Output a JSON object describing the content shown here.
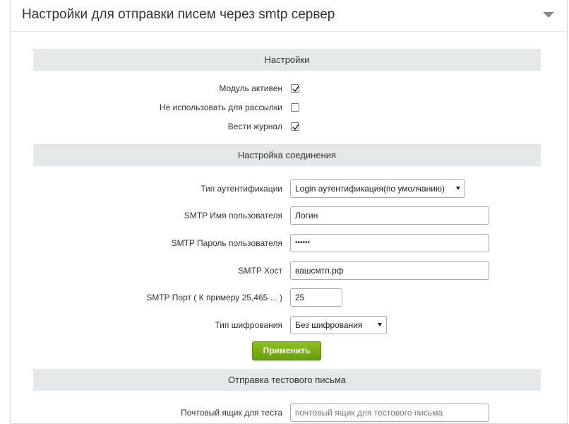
{
  "panel": {
    "title": "Настройки для отправки писем через smtp сервер"
  },
  "sections": {
    "settings": "Настройки",
    "connection": "Настройка соединения",
    "test": "Отправка тестового письма"
  },
  "settings": {
    "module_active": {
      "label": "Модуль активен",
      "checked": true
    },
    "no_mailing": {
      "label": "Не использовать для рассылки",
      "checked": false
    },
    "log": {
      "label": "Вести журнал",
      "checked": true
    }
  },
  "connection": {
    "auth_type": {
      "label": "Тип аутентификации",
      "value": "Login аутентификация(по умолчанию)"
    },
    "username": {
      "label": "SMTP Имя пользователя",
      "value": "Логин"
    },
    "password": {
      "label": "SMTP Пароль пользователя",
      "value": "••••••"
    },
    "host": {
      "label": "SMTP Хост",
      "value": "вашсмтп.рф"
    },
    "port": {
      "label": "SMTP Порт ( К примеру 25,465 ... )",
      "value": "25"
    },
    "encryption": {
      "label": "Тип шифрования",
      "value": "Без шифрования"
    },
    "apply_label": "Применить"
  },
  "test": {
    "email": {
      "label": "Почтовый ящик для теста",
      "placeholder": "почтовый ящик для тестового письма"
    }
  },
  "colors": {
    "section_bg": "#e5e8e8",
    "apply_green": "#7ab317"
  }
}
